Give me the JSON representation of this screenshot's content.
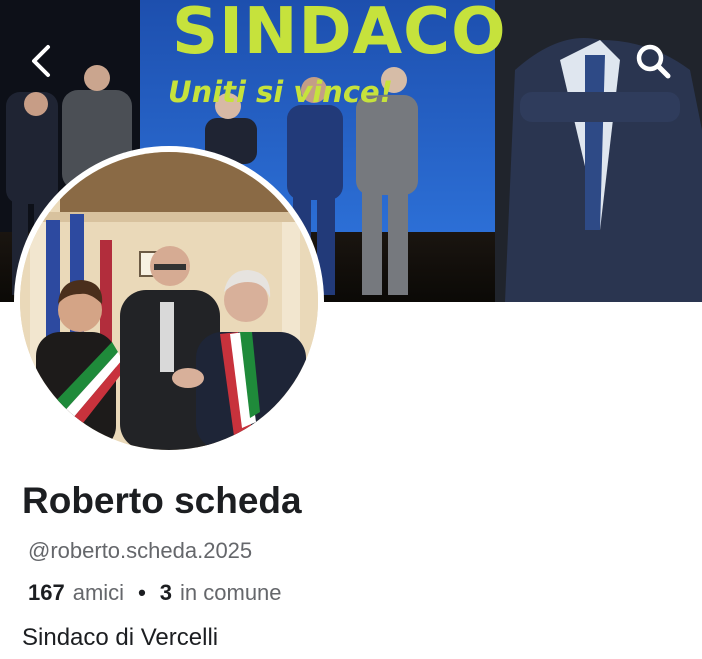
{
  "cover": {
    "banner_title": "SINDACO",
    "banner_slogan": "Uniti si vince!"
  },
  "icons": {
    "back": "chevron-left-icon",
    "search": "search-icon"
  },
  "profile": {
    "name": "Roberto scheda",
    "handle": "@roberto.scheda.2025",
    "friends_count": "167",
    "friends_label": "amici",
    "separator": "•",
    "mutual_count": "3",
    "mutual_label": "in comune",
    "bio": "Sindaco di Vercelli"
  },
  "colors": {
    "banner_text": "#c6e23c",
    "banner_bg": "#2e66c8",
    "name_text": "#1c1e21",
    "secondary_text": "#65676b"
  }
}
